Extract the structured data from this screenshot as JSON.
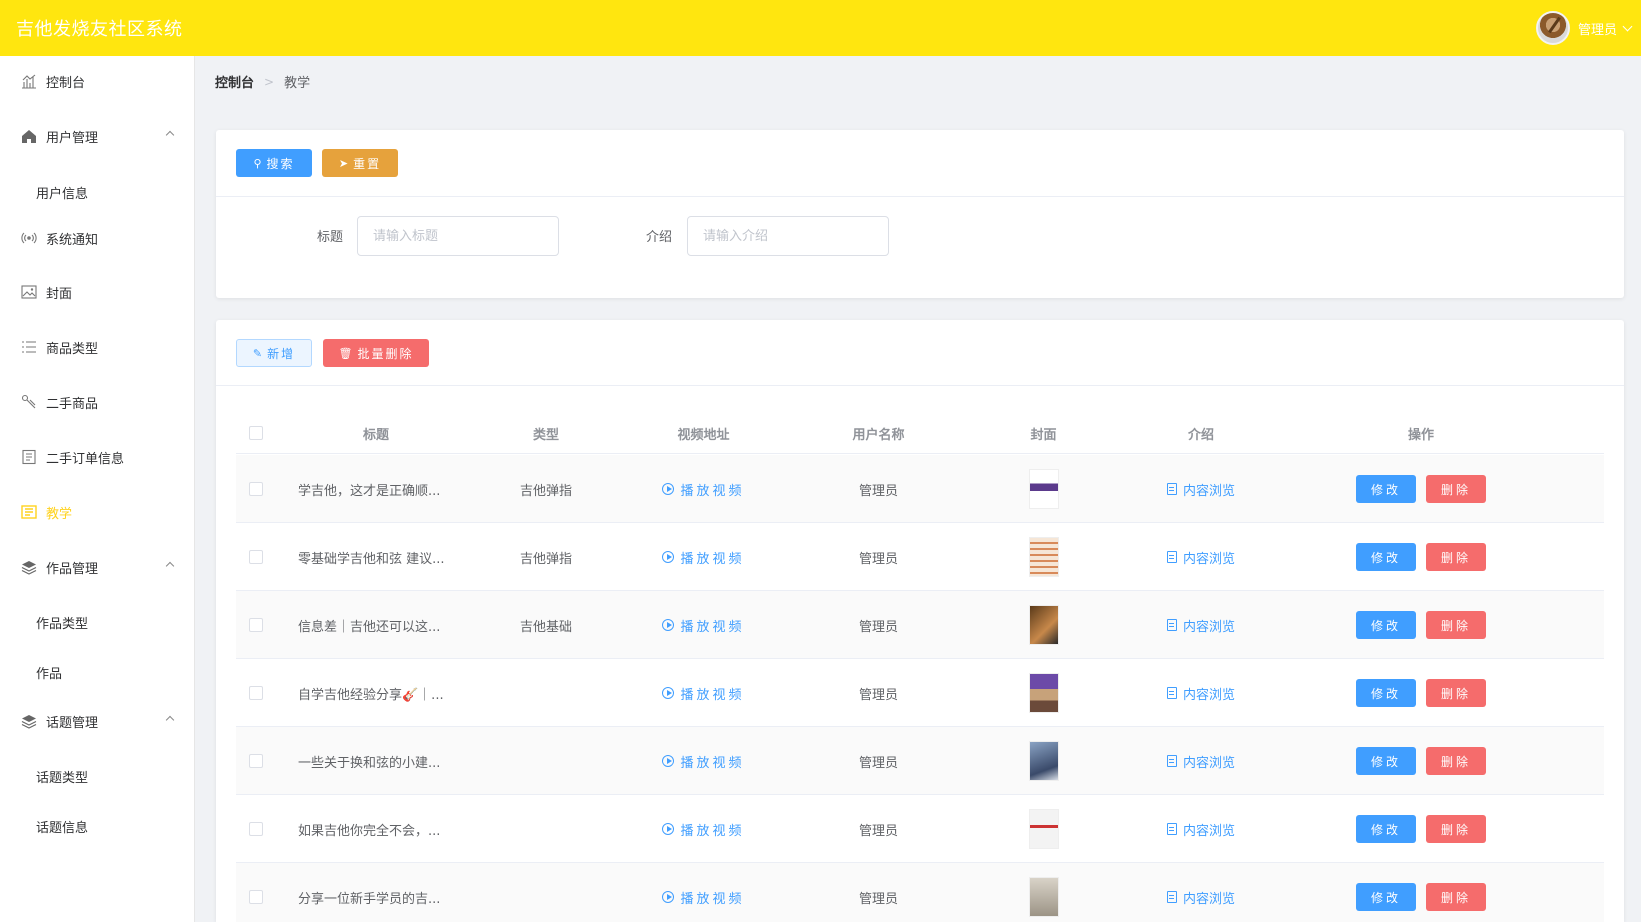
{
  "app": {
    "title": "吉他发烧友社区系统",
    "user": "管理员"
  },
  "sidebar": {
    "items": [
      {
        "label": "控制台"
      },
      {
        "label": "用户管理"
      },
      {
        "label": "用户信息"
      },
      {
        "label": "系统通知"
      },
      {
        "label": "封面"
      },
      {
        "label": "商品类型"
      },
      {
        "label": "二手商品"
      },
      {
        "label": "二手订单信息"
      },
      {
        "label": "教学"
      },
      {
        "label": "作品管理"
      },
      {
        "label": "作品类型"
      },
      {
        "label": "作品"
      },
      {
        "label": "话题管理"
      },
      {
        "label": "话题类型"
      },
      {
        "label": "话题信息"
      }
    ]
  },
  "breadcrumb": {
    "home": "控制台",
    "current": "教学"
  },
  "search": {
    "search_button": "搜索",
    "reset_button": "重置",
    "title_label": "标题",
    "title_placeholder": "请输入标题",
    "intro_label": "介绍",
    "intro_placeholder": "请输入介绍"
  },
  "toolbar": {
    "add_button": "新增",
    "batch_delete_button": "批量删除"
  },
  "table": {
    "columns": [
      "标题",
      "类型",
      "视频地址",
      "用户名称",
      "封面",
      "介绍",
      "操作"
    ],
    "play_text": "播放视频",
    "browse_text": "内容浏览",
    "edit_text": "修改",
    "delete_text": "删除",
    "rows": [
      {
        "title": "学吉他，这才是正确顺...",
        "type": "吉他弹指",
        "user": "管理员"
      },
      {
        "title": "零基础学吉他和弦 建议...",
        "type": "吉他弹指",
        "user": "管理员"
      },
      {
        "title": "信息差｜吉他还可以这...",
        "type": "吉他基础",
        "user": "管理员"
      },
      {
        "title": "自学吉他经验分享🎸｜...",
        "type": "",
        "user": "管理员"
      },
      {
        "title": "一些关于换和弦的小建...",
        "type": "",
        "user": "管理员"
      },
      {
        "title": "如果吉他你完全不会，...",
        "type": "",
        "user": "管理员"
      },
      {
        "title": "分享一位新手学员的吉...",
        "type": "",
        "user": "管理员"
      }
    ]
  },
  "colors": {
    "header": "#ffe60f",
    "primary": "#409eff",
    "warning": "#e6a23c",
    "danger": "#f56c6c",
    "active_nav": "#ffd21e"
  }
}
